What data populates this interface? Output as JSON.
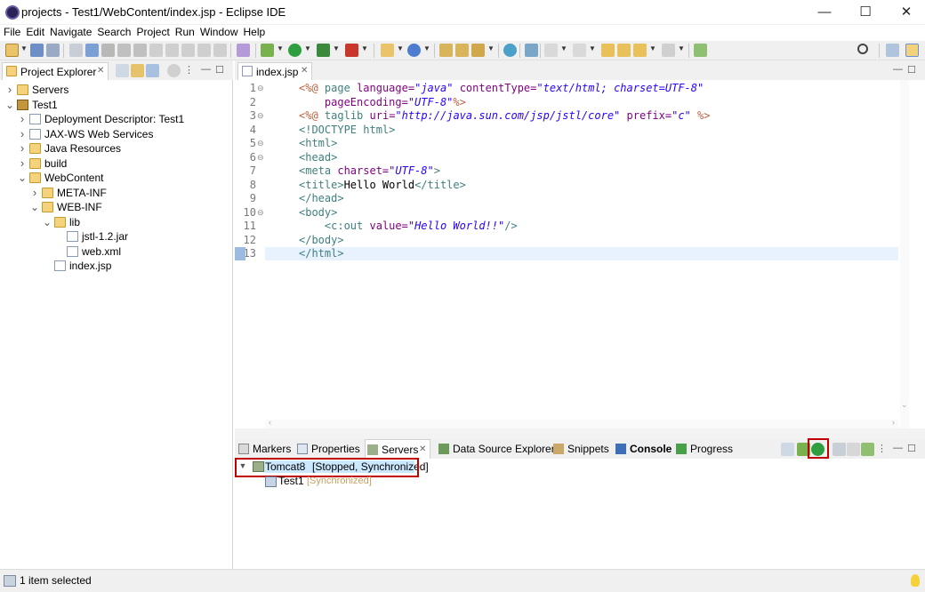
{
  "window": {
    "title": "projects - Test1/WebContent/index.jsp - Eclipse IDE",
    "minimize": "—",
    "maximize": "☐",
    "close": "✕"
  },
  "menu": [
    "File",
    "Edit",
    "Navigate",
    "Search",
    "Project",
    "Run",
    "Window",
    "Help"
  ],
  "project_explorer": {
    "tab_label": "Project Explorer",
    "tab_close": "✕",
    "tree": [
      {
        "label": "Servers",
        "icon": "folder-icon",
        "twisty": "collapsed"
      },
      {
        "label": "Test1",
        "icon": "project-icon",
        "twisty": "expanded"
      },
      {
        "label": "Deployment Descriptor: Test1",
        "icon": "descriptor-icon",
        "twisty": "collapsed"
      },
      {
        "label": "JAX-WS Web Services",
        "icon": "webservice-icon",
        "twisty": "collapsed"
      },
      {
        "label": "Java Resources",
        "icon": "java-resources-icon",
        "twisty": "collapsed"
      },
      {
        "label": "build",
        "icon": "folder-icon",
        "twisty": "collapsed"
      },
      {
        "label": "WebContent",
        "icon": "folder-icon",
        "twisty": "expanded"
      },
      {
        "label": "META-INF",
        "icon": "folder-icon",
        "twisty": "collapsed"
      },
      {
        "label": "WEB-INF",
        "icon": "folder-icon",
        "twisty": "expanded"
      },
      {
        "label": "lib",
        "icon": "folder-icon",
        "twisty": "expanded"
      },
      {
        "label": "jstl-1.2.jar",
        "icon": "jar-icon",
        "twisty": "none"
      },
      {
        "label": "web.xml",
        "icon": "xml-file-icon",
        "twisty": "none"
      },
      {
        "label": "index.jsp",
        "icon": "jsp-file-icon",
        "twisty": "none"
      }
    ]
  },
  "editor": {
    "tab_label": "index.jsp",
    "tab_close": "✕",
    "line_numbers": [
      "1",
      "2",
      "3",
      "4",
      "5",
      "6",
      "7",
      "8",
      "9",
      "10",
      "11",
      "12",
      "13"
    ],
    "fold_markers": {
      "1": "⊖",
      "3": "⊖",
      "5": "⊖",
      "6": "⊖",
      "10": "⊖"
    }
  },
  "bottom_panel": {
    "tabs": [
      "Markers",
      "Properties",
      "Servers",
      "Data Source Explorer",
      "Snippets",
      "Console",
      "Progress"
    ],
    "servers_tab_close": "✕",
    "server": {
      "name": "Tomcat8",
      "state": "[Stopped, Synchronized]"
    },
    "module": {
      "name": "Test1",
      "state": "[Synchronized]"
    }
  },
  "status_bar": {
    "text": "1 item selected"
  },
  "colors": {
    "highlight": "#c00000",
    "selection": "#cce8ff",
    "current_line": "#e8f2fe"
  }
}
